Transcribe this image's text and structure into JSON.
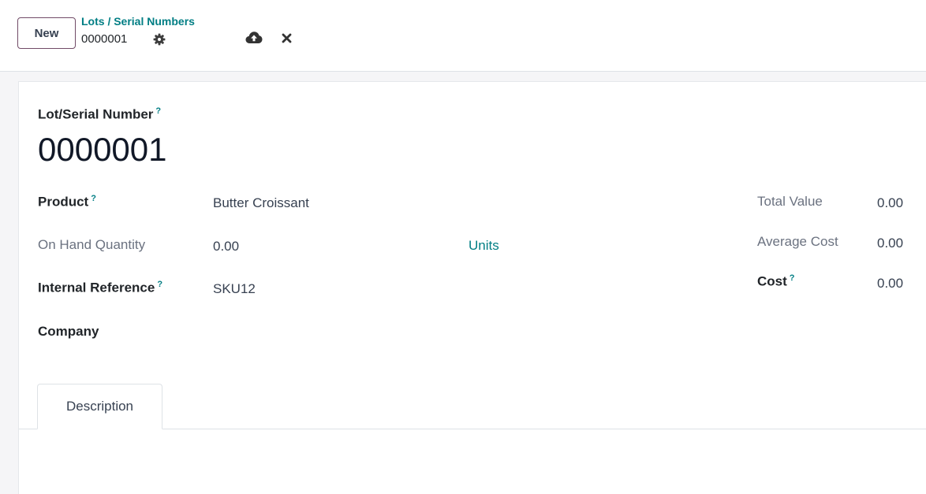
{
  "control_panel": {
    "new_label": "New",
    "breadcrumb": "Lots / Serial Numbers",
    "record_name": "0000001"
  },
  "form": {
    "title_label": "Lot/Serial Number",
    "help_mark": "?",
    "lot_name": "0000001",
    "product_label": "Product",
    "product_value": "Butter Croissant",
    "on_hand_label": "On Hand Quantity",
    "on_hand_value": "0.00",
    "on_hand_uom": "Units",
    "internal_ref_label": "Internal Reference",
    "internal_ref_value": "SKU12",
    "company_label": "Company",
    "total_value_label": "Total Value",
    "total_value": "0.00",
    "average_cost_label": "Average Cost",
    "average_cost": "0.00",
    "cost_label": "Cost",
    "cost": "0.00"
  },
  "tabs": [
    {
      "label": "Description"
    }
  ],
  "icons": {
    "gear": "gear-icon",
    "save": "cloud-upload-icon",
    "discard": "close-icon"
  },
  "colors": {
    "accent": "#017e84",
    "brand": "#714b67"
  }
}
